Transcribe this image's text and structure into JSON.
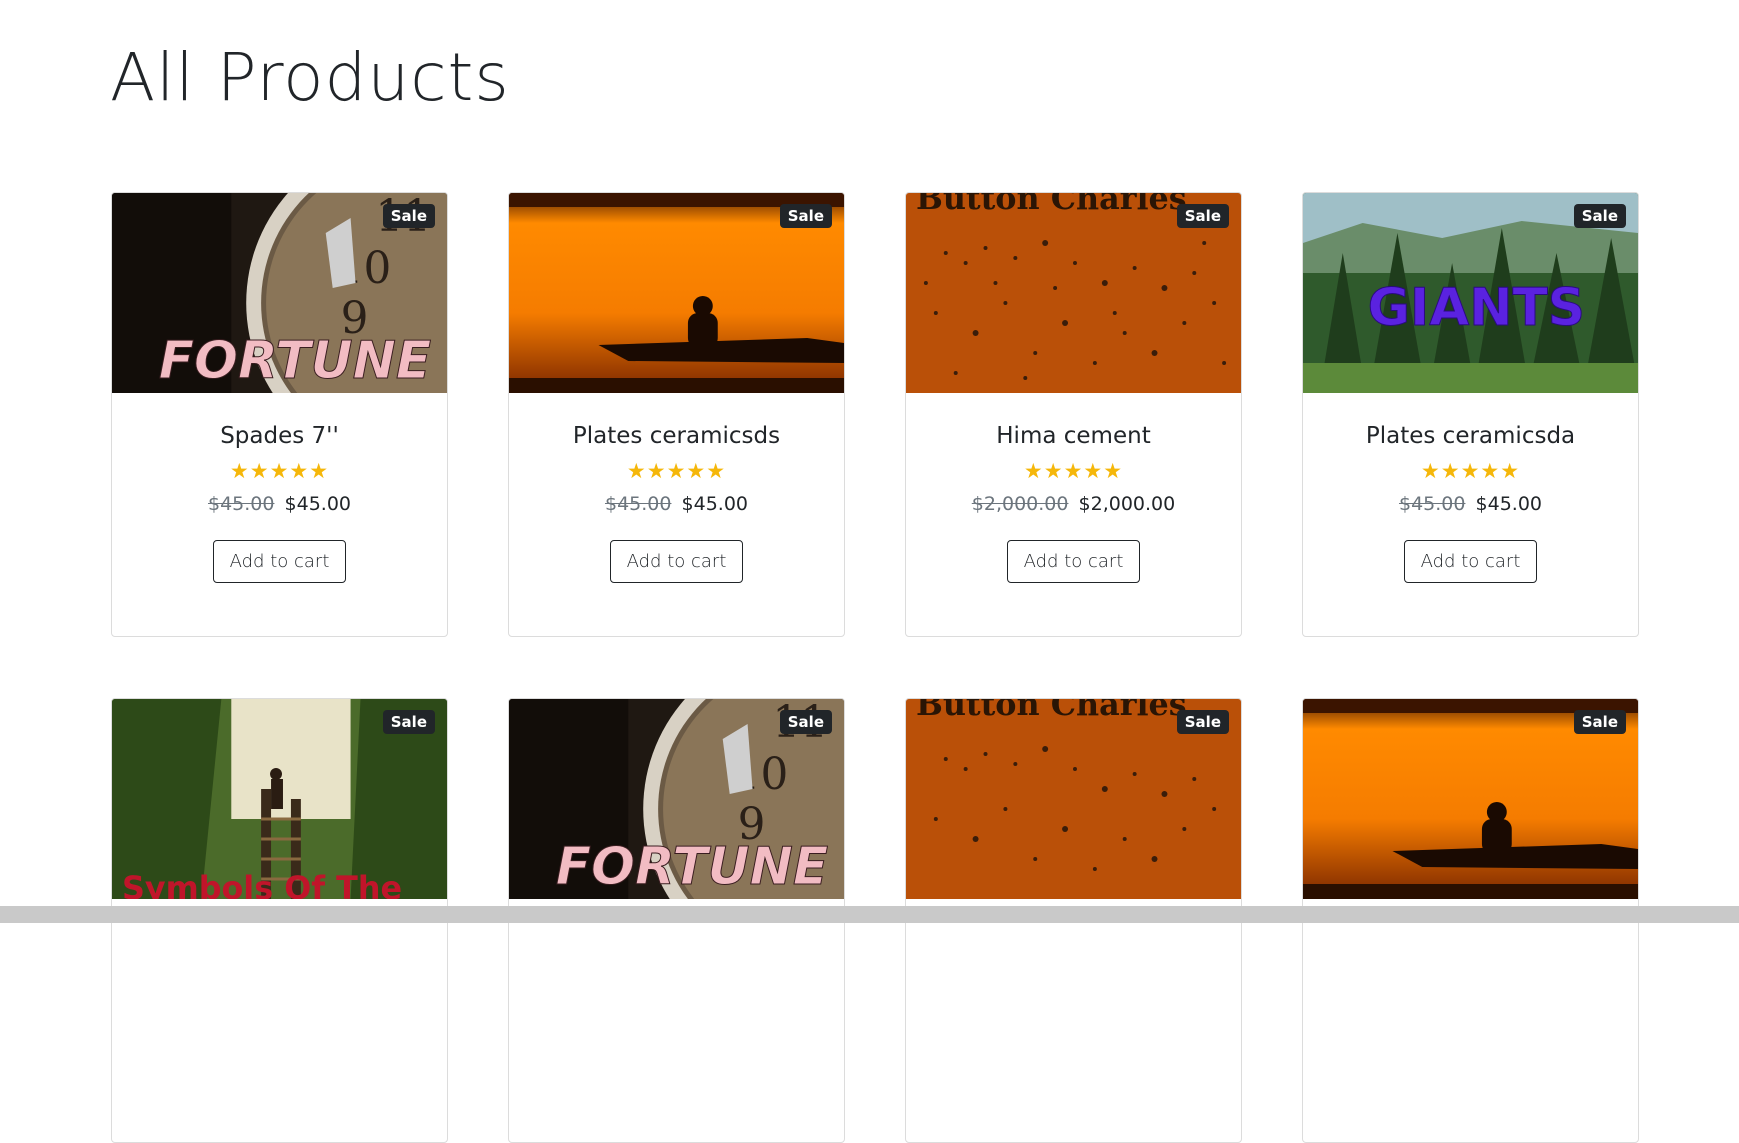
{
  "page": {
    "title": "All Products"
  },
  "badge": {
    "sale": "Sale"
  },
  "products": [
    {
      "name": "Spades 7''",
      "old_price": "$45.00",
      "price": "$45.00",
      "rating": "★★★★★",
      "cta": "Add to cart",
      "image": "clock-fortune"
    },
    {
      "name": "Plates ceramicsds",
      "old_price": "$45.00",
      "price": "$45.00",
      "rating": "★★★★★",
      "cta": "Add to cart",
      "image": "sunset-boat"
    },
    {
      "name": "Hima cement",
      "old_price": "$2,000.00",
      "price": "$2,000.00",
      "rating": "★★★★★",
      "cta": "Add to cart",
      "image": "orange-dew"
    },
    {
      "name": "Plates ceramicsda",
      "old_price": "$45.00",
      "price": "$45.00",
      "rating": "★★★★★",
      "cta": "Add to cart",
      "image": "forest-giants"
    },
    {
      "image": "jungle-stairs"
    },
    {
      "image": "clock-fortune"
    },
    {
      "image": "orange-dew"
    },
    {
      "image": "sunset-boat"
    }
  ],
  "image_text": {
    "fortune": "FORTUNE",
    "giants": "GIANTS",
    "button_charles": "Button Charles",
    "symbols": "Symbols Of The"
  }
}
